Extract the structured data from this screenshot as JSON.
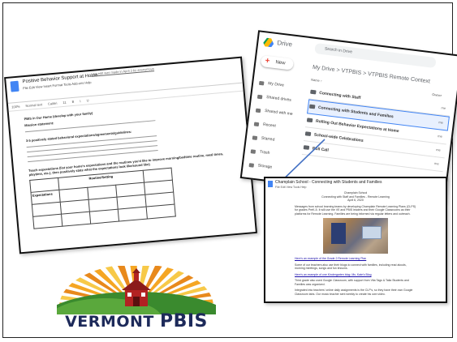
{
  "doc": {
    "title": "Positive Behavior Support at Home",
    "menu": "File  Edit  View  Insert  Format  Tools  Add-ons  Help",
    "last_edit": "Last edit was made in April 3 by anonymous",
    "toolbar": [
      "100%",
      "Normal text",
      "Calibri",
      "11",
      "B",
      "I",
      "U"
    ],
    "heading": "PBIS in Our Home (develop with your family)",
    "mission": "Mission statement:",
    "expectations": "3-5 positively stated behavioral expectations/agreements/guidelines:",
    "routine_prompt": "Teach expectations (list your home's expectations and the routines you'd like to improve morning/bedtime routine, meal times, playtime, etc.), then positively state what the expectations look like/sound like)",
    "table_header": "Routine/Setting",
    "table_row_label": "Expectations"
  },
  "drive": {
    "brand": "Drive",
    "search_placeholder": "Search in Drive",
    "new_label": "New",
    "nav": [
      "My Drive",
      "Shared drives",
      "Shared with me",
      "Recent",
      "Starred",
      "Trash",
      "Storage"
    ],
    "breadcrumb": "My Drive  >  VTPBIS  >  VTPBIS Remote Context",
    "column_name": "Name ↑",
    "column_owner": "Owner",
    "rows": [
      {
        "name": "Connecting with Staff",
        "owner": "me"
      },
      {
        "name": "Connecting with Students and Families",
        "owner": "me"
      },
      {
        "name": "Rolling Out Behavior Expectations at Home",
        "owner": "me"
      },
      {
        "name": "School-wide Celebrations",
        "owner": "me"
      },
      {
        "name": "Roll Call",
        "owner": "me"
      }
    ]
  },
  "mail": {
    "title": "Champlain School - Connecting with Students and Families",
    "menu": "File  Edit  View  Tools  Help",
    "heading_lines": [
      "Champlain School",
      "Connecting with Staff and Families - Remote Learning",
      "April 6, 2020"
    ],
    "para1": "Messages from school learning teams by developing Champlain Remote Learning Plans (CLPS) for grades PreK-5. It will use the VE and PBIS leaders and their Google Classrooms as their platforms for Remote Learning. Families are being informed via regular letters and outreach.",
    "link1": "Here's an example of the Grade 2 Remote Learning Plan",
    "para2": "Some of our teachers also use their blogs to connect with families, including read alouds, morning meetings, songs and fun lessons.",
    "link2": "Here's an example of one Kindergarten blog: Ms. Kate's Blog",
    "para3": "Third grade also used Google Classroom, with support from Vita Tags & Talia Students and Families was organized.",
    "para4": "Integrated into teachers' online daily assignments is the CLP's, so they have their own Google Classroom tabs. Our music teacher sent weekly to create his own video."
  },
  "logo": {
    "word1": "VERMONT",
    "word2": "PBIS",
    "colors": {
      "navy": "#1d2a5a",
      "sun": "#f5a623",
      "hill": "#3a8a2e",
      "barn": "#b22222"
    }
  }
}
